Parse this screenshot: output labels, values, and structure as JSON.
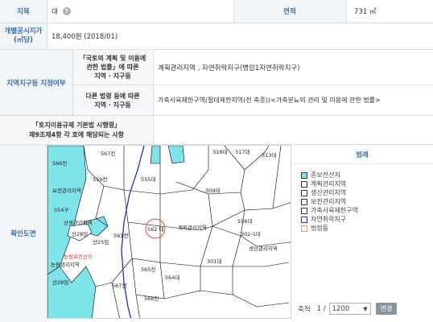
{
  "rows": {
    "jimok_label": "지목",
    "jimok_value": "대",
    "area_label": "면적",
    "area_value": "731 ㎡",
    "price_label": "개별공시지가\n(㎡당)",
    "price_value": "18,400원 (2018/01)",
    "zoning_label": "지역지구등 지정여부",
    "law1_label": "「국토의 계획 및 이용에\n관한 법률」에 따른\n지역 · 지구등",
    "law1_value": "계획관리지역 , 자연취락지구(병암1자연취락지구)",
    "law2_label": "다른 법령 등에 따른\n지역 · 지구등",
    "law2_value": "가축사육제한구역(절대제한지역(전 축종))<가축분뇨의 관리 및 이용에 관한 법률>",
    "decree_label": "「토지이용규제 기본법 시행령」\n제9조제4항 각 호에 해당되는 사항",
    "decree_value": "",
    "map_label": "확인도면"
  },
  "map": {
    "parcels": [
      "567전",
      "566전",
      "559전",
      "555대",
      "318대",
      "317대",
      "313대",
      "보전관리지역",
      "309대",
      "554구",
      "상생관리지역",
      "산28임",
      "561전",
      "562 대",
      "계획관리지역",
      "302-1대",
      "565전",
      "556대",
      "301대",
      "567전",
      "564대",
      "농림관리지역",
      "568전",
      "산28임",
      "산25임",
      "생산관리지역",
      "농림보전산지"
    ]
  },
  "legend": {
    "title": "범례",
    "items": [
      {
        "label": "준보전산지",
        "color": "#7fe3ea"
      },
      {
        "label": "계획관리지역",
        "color": "#ffffff"
      },
      {
        "label": "생산관리지역",
        "color": "#ffffff"
      },
      {
        "label": "보전관리지역",
        "color": "#ffffff"
      },
      {
        "label": "가축사육제한구역",
        "color": "#ffffff"
      },
      {
        "label": "자연취락지구",
        "color": "#ffffff"
      },
      {
        "label": "법정동",
        "color": "#ffffff"
      }
    ],
    "scale_label": "축적",
    "scale_prefix": "1 /",
    "scale_value": "1200",
    "change_button": "변경"
  },
  "colors": {
    "accent": "#3a6ea8",
    "cyan": "#7fe3ea",
    "blue_line": "#1f2fd6",
    "red_circle": "#e0443a"
  }
}
